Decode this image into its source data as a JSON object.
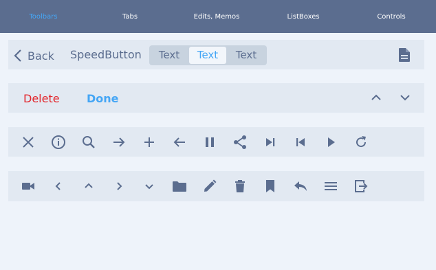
{
  "tabs": [
    {
      "label": "Toolbars",
      "active": true
    },
    {
      "label": "Tabs",
      "active": false
    },
    {
      "label": "Edits, Memos",
      "active": false
    },
    {
      "label": "ListBoxes",
      "active": false
    },
    {
      "label": "Controls",
      "active": false
    }
  ],
  "toolbar1": {
    "back_label": "Back",
    "speed_label": "SpeedButton",
    "segments": [
      "Text",
      "Text",
      "Text"
    ],
    "selected_segment": 1
  },
  "toolbar2": {
    "delete_label": "Delete",
    "done_label": "Done"
  },
  "icons_row1": [
    "close-icon",
    "info-icon",
    "search-icon",
    "arrow-right-icon",
    "plus-icon",
    "arrow-left-icon",
    "pause-icon",
    "share-icon",
    "skip-next-icon",
    "skip-previous-icon",
    "play-icon",
    "refresh-icon"
  ],
  "icons_row2": [
    "camera-icon",
    "chevron-left-icon",
    "chevron-up-icon",
    "chevron-right-icon",
    "chevron-down-icon",
    "folder-icon",
    "pencil-icon",
    "trash-icon",
    "bookmark-icon",
    "reply-icon",
    "menu-icon",
    "exit-icon"
  ],
  "colors": {
    "header": "#5b6d8f",
    "accent": "#45a6f5",
    "delete": "#e3262c",
    "bar": "#e2e9f2",
    "background": "#eef3fa",
    "icon": "#5b6d8f"
  }
}
